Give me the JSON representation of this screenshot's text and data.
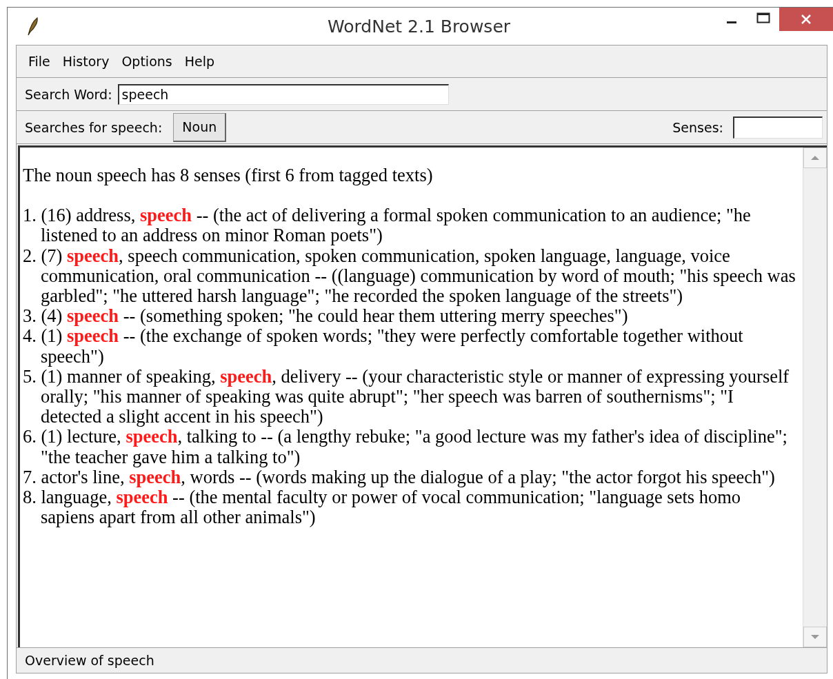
{
  "window": {
    "title": "WordNet 2.1 Browser"
  },
  "menu": [
    "File",
    "History",
    "Options",
    "Help"
  ],
  "search": {
    "label": "Search Word:",
    "value": "speech"
  },
  "searches": {
    "label": "Searches for speech:",
    "buttons": [
      "Noun"
    ],
    "senses_label": "Senses:"
  },
  "overview": {
    "heading": "The noun speech has 8 senses (first 6 from tagged texts)",
    "senses": [
      "1. (16) address, **speech** -- (the act of delivering a formal spoken communication to an audience; \"he listened to an address on minor Roman poets\")",
      "2. (7) **speech**, speech communication, spoken communication, spoken language, language, voice communication, oral communication -- ((language) communication by word of mouth; \"his speech was garbled\"; \"he uttered harsh language\"; \"he recorded the spoken language of the streets\")",
      "3. (4) **speech** -- (something spoken; \"he could hear them uttering merry speeches\")",
      "4. (1) **speech** -- (the exchange of spoken words; \"they were perfectly comfortable together without speech\")",
      "5. (1) manner of speaking, **speech**, delivery -- (your characteristic style or manner of expressing yourself orally; \"his manner of speaking was quite abrupt\"; \"her speech was barren of southernisms\"; \"I detected a slight accent in his speech\")",
      "6. (1) lecture, **speech**, talking to -- (a lengthy rebuke; \"a good lecture was my father's idea of discipline\"; \"the teacher gave him a talking to\")",
      "7. actor's line, **speech**, words -- (words making up the dialogue of a play; \"the actor forgot his speech\")",
      "8. language, **speech** -- (the mental faculty or power of vocal communication; \"language sets homo sapiens apart from all other animals\")"
    ]
  },
  "status_bar": "Overview of speech"
}
